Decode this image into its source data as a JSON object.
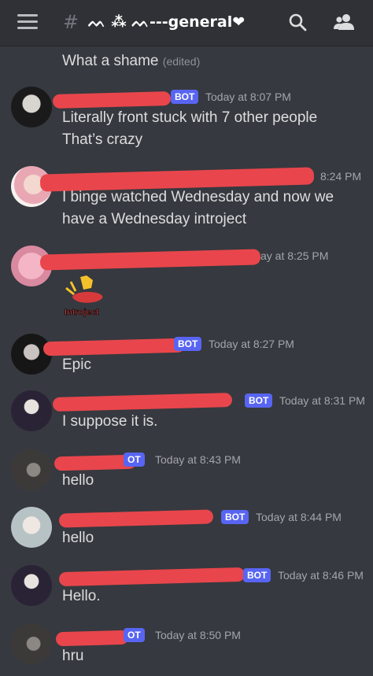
{
  "header": {
    "channel_name": "ᨓ ⁂ ᨓ---general❤",
    "hash": "#"
  },
  "messages": [
    {
      "text_lines": [
        "What a shame"
      ],
      "edited_label": "(edited)"
    },
    {
      "bot_label": "BOT",
      "time": "Today at 8:07 PM",
      "text_lines": [
        "Literally front stuck with 7 other people",
        "That’s crazy"
      ]
    },
    {
      "time": "8:24 PM",
      "text_lines": [
        "I binge watched Wednesday and now we",
        "have a Wednesday introject"
      ]
    },
    {
      "time": "ay at 8:25 PM",
      "sticker_label": "Introject"
    },
    {
      "bot_label": "BOT",
      "time": "Today at 8:27 PM",
      "text_lines": [
        "Epic"
      ]
    },
    {
      "bot_label": "BOT",
      "time": "Today at 8:31 PM",
      "text_lines": [
        "I suppose it is."
      ]
    },
    {
      "bot_label": "OT",
      "time": "Today at 8:43 PM",
      "text_lines": [
        "hello"
      ]
    },
    {
      "bot_label": "BOT",
      "time": "Today at 8:44 PM",
      "text_lines": [
        "hello"
      ]
    },
    {
      "bot_label": "BOT",
      "time": "Today at 8:46 PM",
      "text_lines": [
        "Hello."
      ]
    },
    {
      "bot_label": "OT",
      "time": "Today at 8:50 PM",
      "text_lines": [
        "hru"
      ]
    }
  ],
  "colors": {
    "background": "#36393f",
    "header": "#2f3136",
    "bot_badge": "#5865f2",
    "redaction": "#e8464c"
  },
  "icons": [
    "menu-icon",
    "hash-icon",
    "search-icon",
    "members-icon"
  ]
}
